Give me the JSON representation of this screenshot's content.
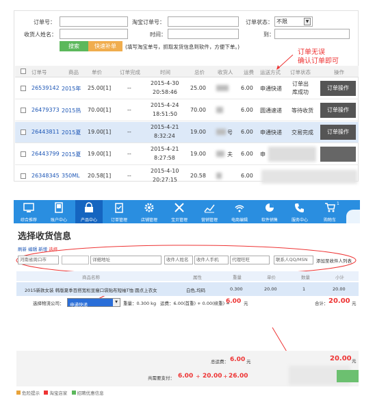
{
  "filters": {
    "order_no_label": "订单号：",
    "taobao_order_label": "淘宝订单号：",
    "order_status_label": "订单状态：",
    "order_status_value": "不限",
    "receiver_label": "收货人姓名：",
    "time_label": "时间：",
    "to_label": "到：",
    "search_btn": "搜索",
    "quick_fill_btn": "快速补单",
    "hint": "(填写淘宝单号，抓取发货信息到软件，方便下单。)"
  },
  "annotation": {
    "line1": "订单无误",
    "line2": "确认订单即可"
  },
  "orders_header": [
    "订单号",
    "商品",
    "单价",
    "订单完成",
    "时间",
    "总价",
    "收货人",
    "运费",
    "运送方式",
    "订单状态",
    "操作"
  ],
  "orders": [
    {
      "id": "26539142",
      "item": "2015年",
      "price": "25.00[1]",
      "done": "--",
      "date": "2015-4-30",
      "time": "20:58:46",
      "total": "25.00",
      "receiver": "",
      "fee": "6.00",
      "ship": "申通快递",
      "status": "订单出库成功",
      "op": "订单操作"
    },
    {
      "id": "26479373",
      "item": "2015热",
      "price": "70.00[1]",
      "done": "--",
      "date": "2015-4-24",
      "time": "18:51:50",
      "total": "70.00",
      "receiver": "",
      "fee": "6.00",
      "ship": "圆通速递",
      "status": "等待收货",
      "op": "订单操作"
    },
    {
      "id": "26443811",
      "item": "2015夏",
      "price": "19.00[1]",
      "done": "--",
      "date": "2015-4-21",
      "time": "8:32:24",
      "total": "19.00",
      "receiver": "号",
      "fee": "6.00",
      "ship": "申通快递",
      "status": "交易完成",
      "op": "订单操作"
    },
    {
      "id": "26443799",
      "item": "2015夏",
      "price": "19.00[1]",
      "done": "--",
      "date": "2015-4-21",
      "time": "8:27:58",
      "total": "19.00",
      "receiver": "夫",
      "fee": "6.00",
      "ship": "申",
      "status": "",
      "op": ""
    },
    {
      "id": "26348345",
      "item": "350ML",
      "price": "20.58[1]",
      "done": "--",
      "date": "2015-4-10",
      "time": "20:27:15",
      "total": "20.58",
      "receiver": "",
      "fee": "6.00",
      "ship": "",
      "status": "",
      "op": ""
    }
  ],
  "nav": [
    {
      "label": "综合推荐",
      "icon": "monitor-icon"
    },
    {
      "label": "账户中心",
      "icon": "phone-icon"
    },
    {
      "label": "产品中心",
      "icon": "lock-icon"
    },
    {
      "label": "订单管理",
      "icon": "clipboard-icon"
    },
    {
      "label": "店铺管理",
      "icon": "gear-icon"
    },
    {
      "label": "宝贝管理",
      "icon": "tools-icon"
    },
    {
      "label": "营销管理",
      "icon": "chart-icon"
    },
    {
      "label": "电商编辑",
      "icon": "wifi-icon"
    },
    {
      "label": "软件销售",
      "icon": "pie-icon"
    },
    {
      "label": "服务中心",
      "icon": "handset-icon"
    },
    {
      "label": "购物车",
      "icon": "cart-icon"
    }
  ],
  "cart_count": "1",
  "checkout": {
    "title": "选择收货信息",
    "tabs": [
      "刷新",
      "编辑",
      "新增",
      "选择"
    ],
    "addr_city": "河南省周口市",
    "addr_detail_ph": "详细地址",
    "receiver_name_ph": "收件人姓名",
    "receiver_phone_ph": "收件人手机",
    "wangwang_ph": "代理旺旺",
    "qq_ph": "联系人QQ/MSN",
    "add_to_list": "添加至收件人列表",
    "table_header": {
      "product": "商品名称",
      "attr": "属性",
      "weight": "重量",
      "price": "单价",
      "qty": "数量",
      "subtotal": "小计"
    },
    "item": {
      "name": "2015新款女装 韩版夏季百搭宽松显瘦口袋贴布短袖T恤 圆点上衣女",
      "attr": "白色,均码",
      "weight": "0.300",
      "price": "20.00",
      "qty": "1",
      "subtotal": "20.00"
    },
    "logistics_label": "选择物流公司：",
    "logistics_value": "申通快递",
    "weight_text": "重量：0.300 kg",
    "fee_text": "运费：6.00(首重) + 0.00(续重) =",
    "fee_total": "6.00",
    "fee_unit": "元",
    "subtotal_label": "合计：",
    "subtotal_value": "20.00",
    "subtotal_unit": "元",
    "total_fee_label": "总运费：",
    "total_fee_value": "6.00",
    "total_fee_unit": "元",
    "right_total": "20.00",
    "right_total_unit": "元",
    "pay_label": "共需要支付：",
    "pay_a": "6.00",
    "pay_plus1": "+",
    "pay_b": "20.00",
    "pay_plus2": "+",
    "pay_c": "26.00",
    "footer_links": [
      "危险提示",
      "淘宝店家",
      "招聘优惠信息"
    ]
  }
}
